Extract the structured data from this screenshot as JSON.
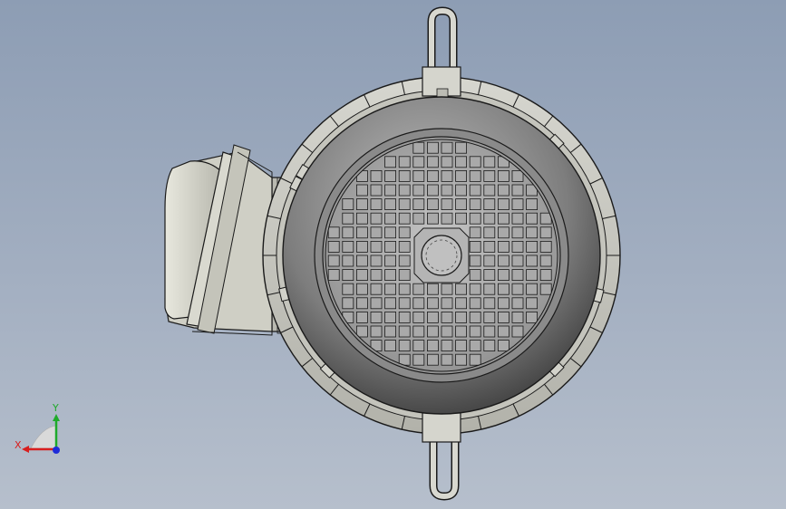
{
  "viewport": {
    "background_top": "#8d9db4",
    "background_bottom": "#b6bfcc"
  },
  "model": {
    "name": "motor-rear-view",
    "metal_color": "#c9c9c2",
    "dark_color": "#5a5a5a",
    "edge_color": "#1a1a1a",
    "grille_rows": 16,
    "grille_cols": 16
  },
  "triad": {
    "x_label": "X",
    "y_label": "Y",
    "x_color": "#d81e1e",
    "y_color": "#1faa2a",
    "z_color": "#1e2bd8"
  }
}
